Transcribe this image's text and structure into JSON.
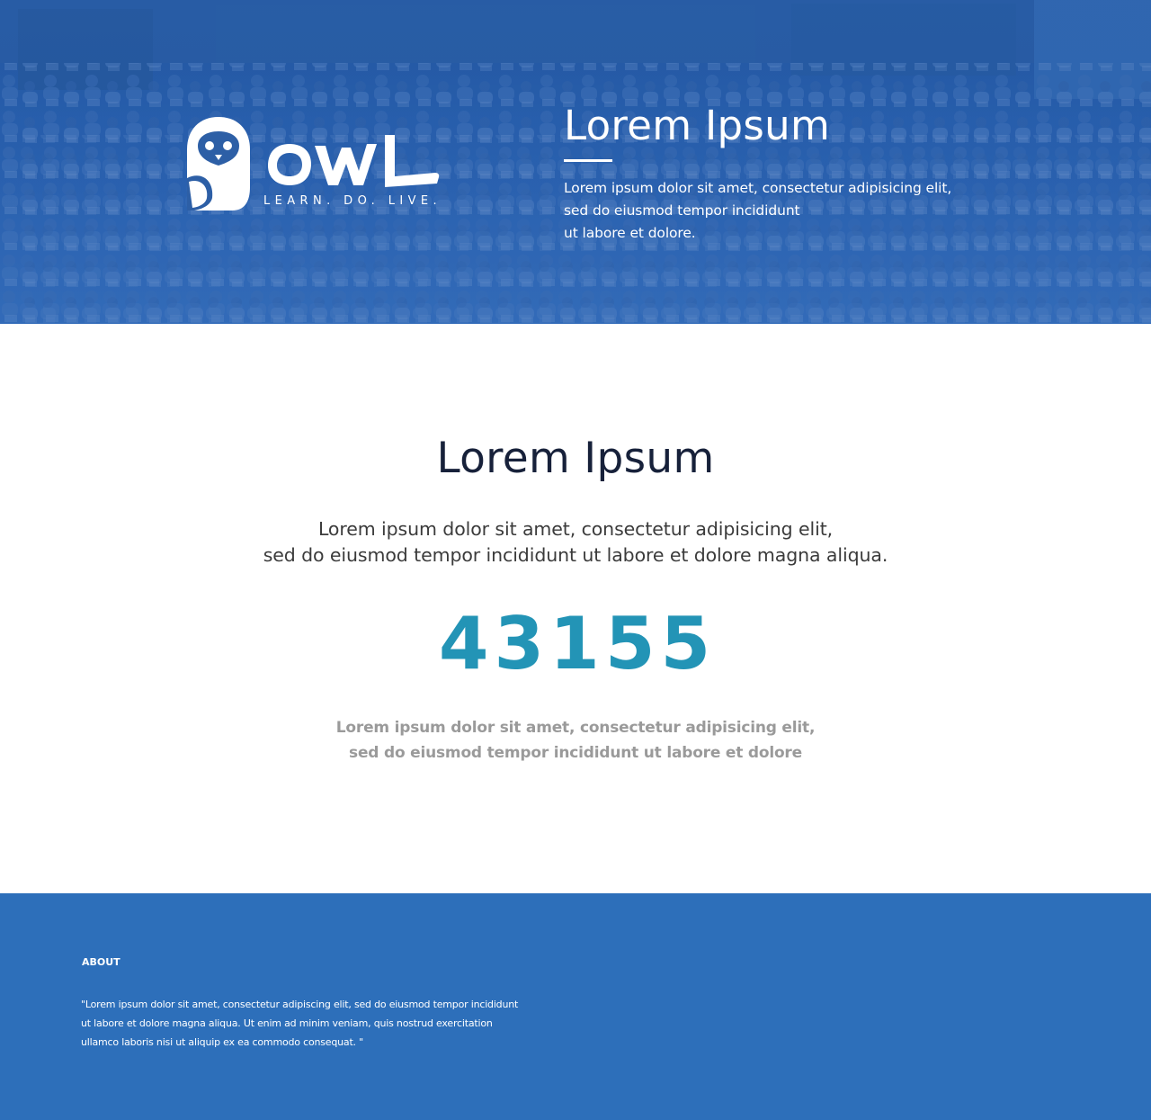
{
  "hero": {
    "background": "lecture-hall-audience-photo",
    "logo": {
      "icon": "owl-icon",
      "wordmark": "OWL",
      "tagline": "LEARN. DO. LIVE."
    },
    "title": "Lorem Ipsum",
    "text_lines": [
      "Lorem ipsum dolor sit amet, consectetur adipisicing elit,",
      "sed do eiusmod tempor incididunt",
      "ut labore et dolore."
    ]
  },
  "main": {
    "title": "Lorem Ipsum",
    "text_lines": [
      "Lorem ipsum dolor sit amet, consectetur adipisicing elit,",
      "sed do eiusmod tempor incididunt ut labore et dolore magna aliqua."
    ],
    "counter": "43155",
    "sub_lines": [
      "Lorem ipsum dolor sit amet, consectetur adipisicing elit,",
      "sed do eiusmod tempor incididunt ut labore et dolore"
    ]
  },
  "footer": {
    "about_heading": "ABOUT",
    "about_lines": [
      "\"Lorem ipsum dolor sit amet, consectetur adipiscing elit, sed do eiusmod tempor incididunt",
      "ut labore et dolore magna aliqua. Ut enim ad minim veniam, quis nostrud exercitation",
      "ullamco laboris nisi ut aliquip ex ea commodo consequat. \""
    ]
  },
  "colors": {
    "hero_overlay": "#2c5ea3",
    "counter": "#2394b6",
    "title_dark": "#17213a",
    "sub_gray": "#9a9a9a",
    "footer_bg": "#2d6fba"
  }
}
